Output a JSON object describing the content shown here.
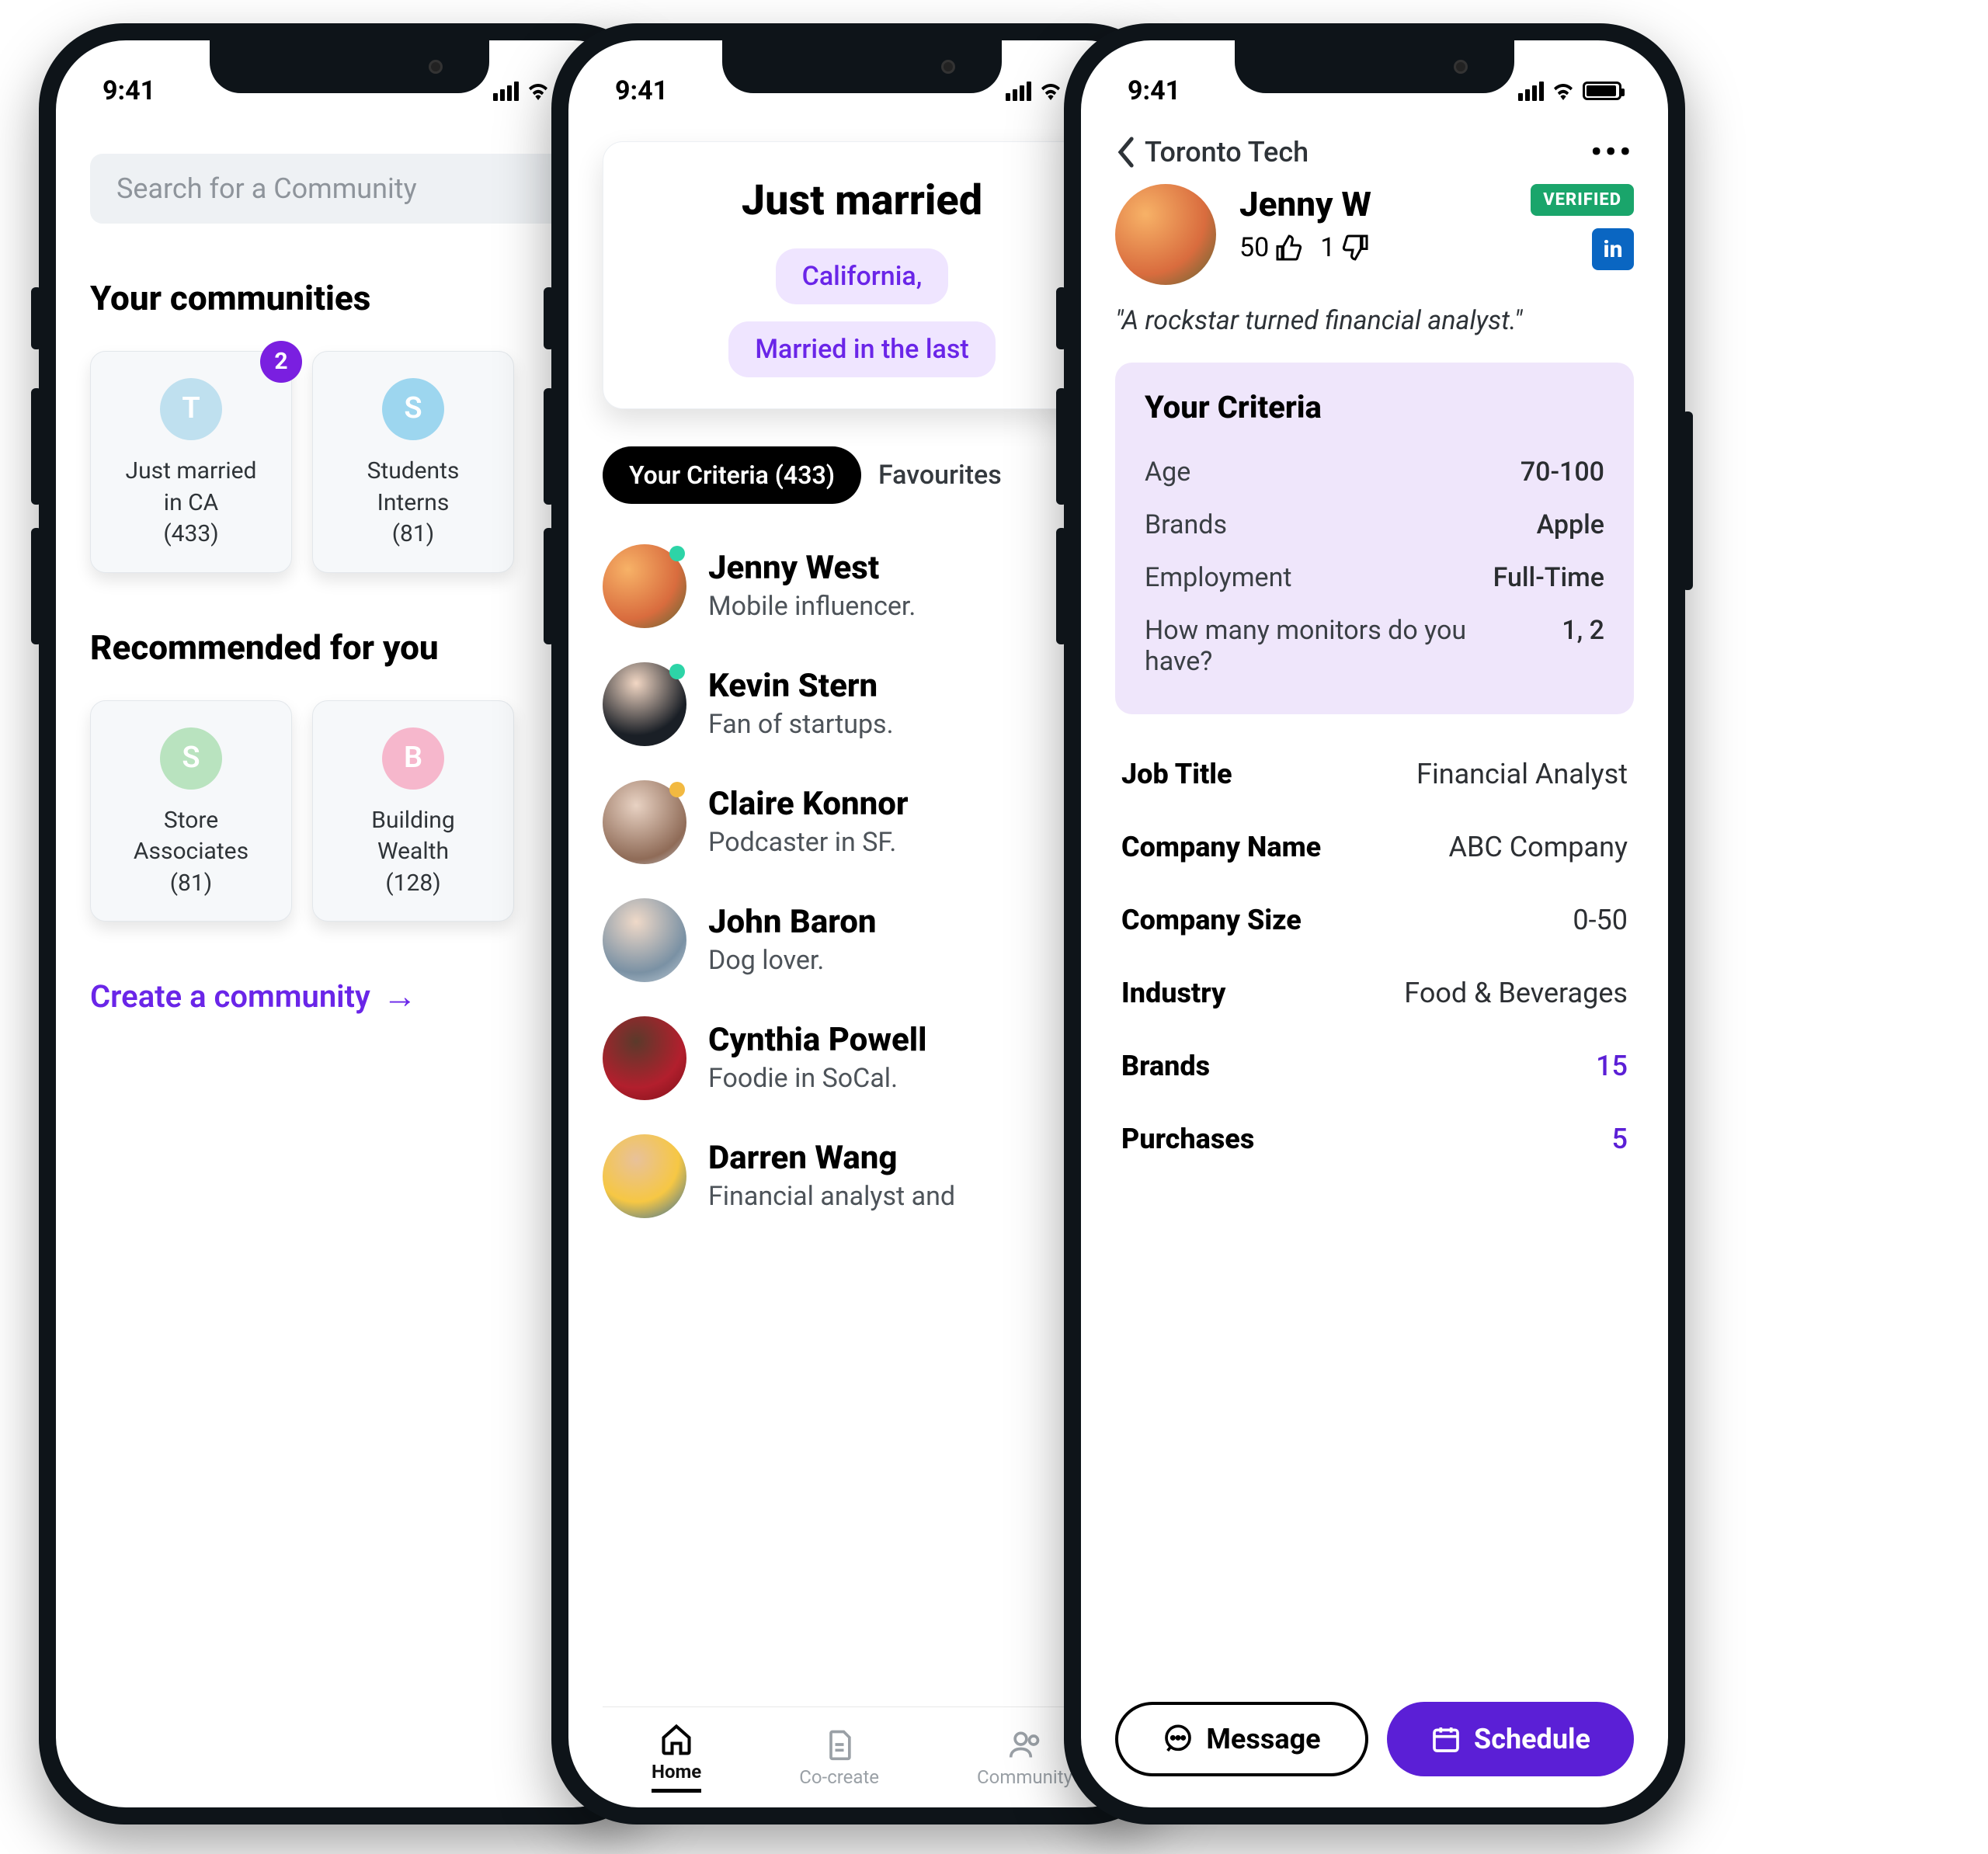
{
  "status": {
    "time": "9:41"
  },
  "screen1": {
    "search_placeholder": "Search for a Community",
    "your_communities_title": "Your communities",
    "communities": [
      {
        "letter": "T",
        "color": "#bfe0ef",
        "name": "Just married in CA",
        "count": "(433)",
        "badge": "2"
      },
      {
        "letter": "S",
        "color": "#9dd6ef",
        "name": "Students Interns",
        "count": "(81)"
      }
    ],
    "recommended_title": "Recommended for you",
    "recommended": [
      {
        "letter": "S",
        "color": "#b9e3bf",
        "name": "Store Associates",
        "count": "(81)"
      },
      {
        "letter": "B",
        "color": "#f6b7cc",
        "name": "Building Wealth",
        "count": "(128)"
      }
    ],
    "create_link": "Create a community"
  },
  "screen2": {
    "card_title": "Just married",
    "chips": [
      "California,",
      "Married in the last"
    ],
    "tab_active": "Your Criteria (433)",
    "tab_second": "Favourites",
    "people": [
      {
        "name": "Jenny West",
        "sub": "Mobile influencer.",
        "av": "av1",
        "dot": "#2dd4a7"
      },
      {
        "name": "Kevin Stern",
        "sub": "Fan of startups.",
        "av": "av2",
        "dot": "#2dd4a7"
      },
      {
        "name": "Claire Konnor",
        "sub": "Podcaster in SF.",
        "av": "av3",
        "dot": "#f2b941"
      },
      {
        "name": "John Baron",
        "sub": "Dog lover.",
        "av": "av4",
        "dot": ""
      },
      {
        "name": "Cynthia Powell",
        "sub": "Foodie in SoCal.",
        "av": "av5",
        "dot": ""
      },
      {
        "name": "Darren Wang",
        "sub": "Financial analyst and",
        "av": "av6",
        "dot": ""
      }
    ],
    "nav": {
      "home": "Home",
      "cocreate": "Co-create",
      "community": "Community"
    }
  },
  "screen3": {
    "back_label": "Toronto Tech",
    "name": "Jenny W",
    "verified": "VERIFIED",
    "likes": "50",
    "dislikes": "1",
    "bio": "\"A rockstar turned financial analyst.\"",
    "criteria_title": "Your Criteria",
    "criteria": [
      {
        "lab": "Age",
        "val": "70-100"
      },
      {
        "lab": "Brands",
        "val": "Apple"
      },
      {
        "lab": "Employment",
        "val": "Full-Time"
      },
      {
        "lab": "How many monitors do you have?",
        "val": "1, 2"
      }
    ],
    "details": [
      {
        "lab": "Job Title",
        "val": "Financial Analyst"
      },
      {
        "lab": "Company Name",
        "val": "ABC Company"
      },
      {
        "lab": "Company Size",
        "val": "0-50"
      },
      {
        "lab": "Industry",
        "val": "Food & Beverages"
      },
      {
        "lab": "Brands",
        "val": "15",
        "link": true
      },
      {
        "lab": "Purchases",
        "val": "5",
        "link": true
      }
    ],
    "message_btn": "Message",
    "schedule_btn": "Schedule"
  }
}
